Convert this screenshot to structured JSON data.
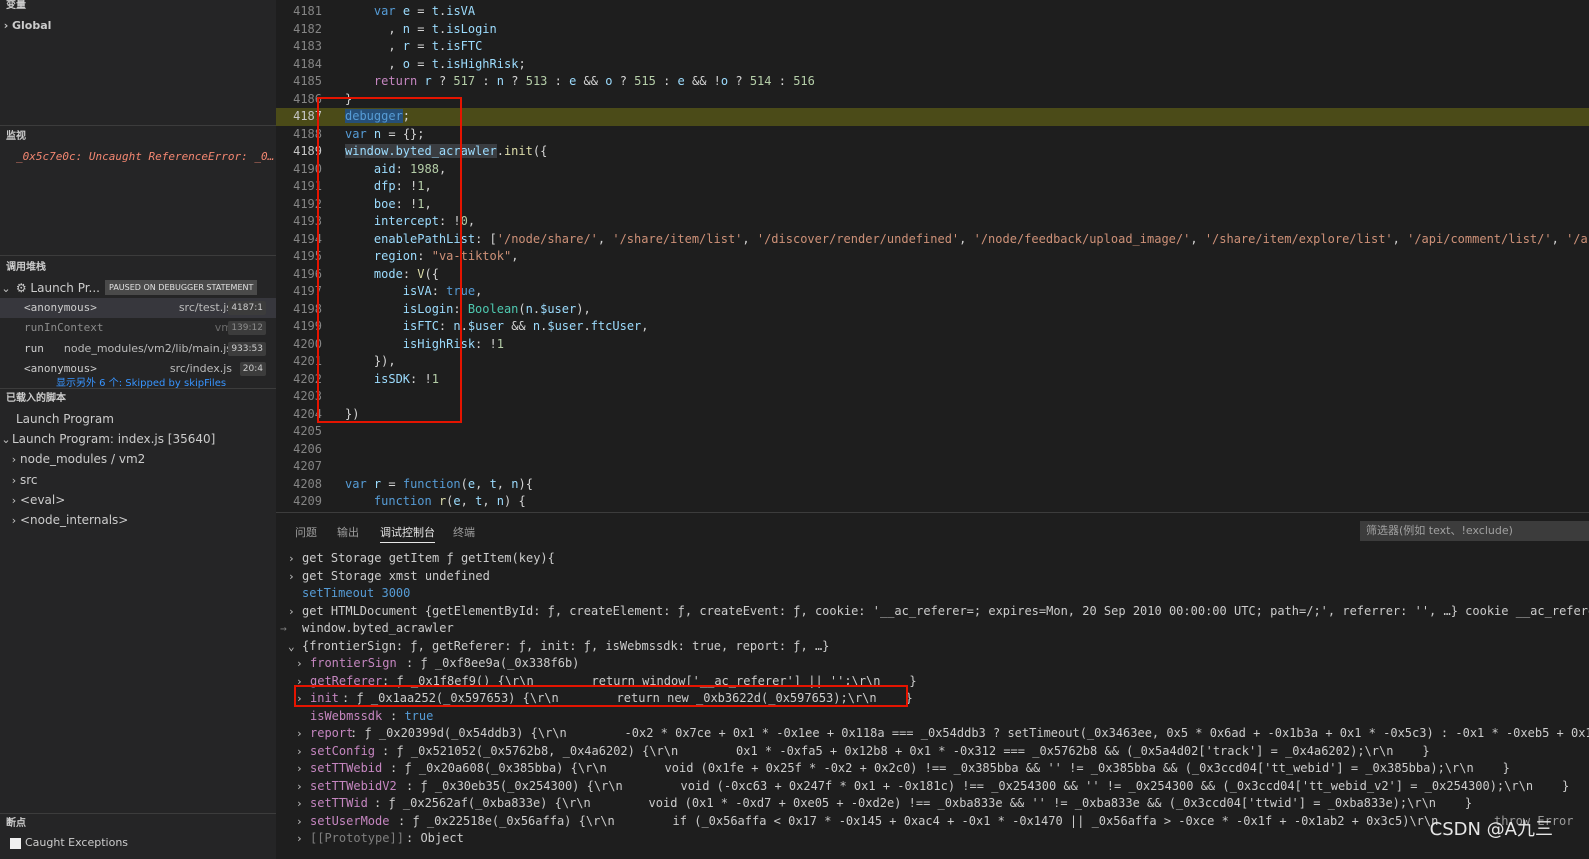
{
  "sidebar": {
    "variables_header": "变量",
    "global_label": "Global",
    "watch_header": "监视",
    "watch_item": "_0x5c7e0c: Uncaught ReferenceError: _0…",
    "callstack_header": "调用堆栈",
    "launch_label": "Launch Pr...",
    "paused_badge": "PAUSED ON DEBUGGER STATEMENT",
    "stack": [
      {
        "fn": "<anonymous>",
        "file": "src/test.js",
        "pos": "4187:1"
      },
      {
        "fn": "runInContext",
        "file": "vm",
        "pos": "139:12"
      },
      {
        "fn": "run",
        "file": "node_modules/vm2/lib/main.js",
        "pos": "933:53"
      },
      {
        "fn": "<anonymous>",
        "file": "src/index.js",
        "pos": "20:4"
      }
    ],
    "skipped_frames": "显示另外 6 个: Skipped by skipFiles",
    "loaded_scripts_header": "已载入的脚本",
    "scripts": [
      "Launch Program",
      "Launch Program: index.js [35640]",
      "node_modules / vm2",
      "src",
      "<eval>",
      "<node_internals>"
    ],
    "breakpoints_header": "断点",
    "caught_exceptions": "Caught Exceptions"
  },
  "editor": {
    "line_numbers": [
      "4181",
      "4182",
      "4183",
      "4184",
      "4185",
      "4186",
      "4187",
      "4188",
      "4189",
      "4190",
      "4191",
      "4192",
      "4193",
      "4194",
      "4195",
      "4196",
      "4197",
      "4198",
      "4199",
      "4200",
      "4201",
      "4202",
      "4203",
      "4204",
      "4205",
      "4206",
      "4207",
      "4208",
      "4209"
    ],
    "current_line": "4187"
  },
  "panel": {
    "tabs": [
      "问题",
      "输出",
      "调试控制台",
      "终端"
    ],
    "active_tab": "调试控制台",
    "filter_placeholder": "筛选器(例如 text、!exclude)",
    "console": {
      "storage_getitem": "get Storage getItem ƒ getItem(key){",
      "storage_xmst": "get Storage xmst undefined",
      "settimeout": "setTimeout 3000",
      "htmldoc": "get HTMLDocument {getElementById: ƒ, createElement: ƒ, createEvent: ƒ, cookie: '__ac_referer=; expires=Mon, 20 Sep 2010 00:00:00 UTC; path=/;', referrer: '', …} cookie __ac_referer",
      "input": "window.byted_acrawler",
      "result": "{frontierSign: ƒ, getReferer: ƒ, init: ƒ, isWebmssdk: true, report: ƒ, …}",
      "props": [
        {
          "key": "frontierSign",
          "val": "ƒ _0xf8ee9a(_0x338f6b)"
        },
        {
          "key": "getReferer",
          "val": "ƒ _0x1f8ef9() {\\r\\n        return window['__ac_referer'] || '';\\r\\n    }"
        },
        {
          "key": "init",
          "val": "ƒ _0x1aa252(_0x597653) {\\r\\n        return new _0xb3622d(_0x597653);\\r\\n    }"
        },
        {
          "key": "isWebmssdk",
          "val": "true"
        },
        {
          "key": "report",
          "val": "ƒ _0x20399d(_0x54ddb3) {\\r\\n        -0x2 * 0x7ce + 0x1 * -0x1ee + 0x118a === _0x54ddb3 ? setTimeout(_0x3463ee, 0x5 * 0x6ad + -0x1b3a + 0x1 * -0x5c3) : -0x1 * -0xeb5 + 0x1"
        },
        {
          "key": "setConfig",
          "val": "ƒ _0x521052(_0x5762b8, _0x4a6202) {\\r\\n        0x1 * -0xfa5 + 0x12b8 + 0x1 * -0x312 === _0x5762b8 && (_0x5a4d02['track'] = _0x4a6202);\\r\\n    }"
        },
        {
          "key": "setTTWebid",
          "val": "ƒ _0x20a608(_0x385bba) {\\r\\n        void (0x1fe + 0x25f * -0x2 + 0x2c0) !== _0x385bba && '' != _0x385bba && (_0x3ccd04['tt_webid'] = _0x385bba);\\r\\n    }"
        },
        {
          "key": "setTTWebidV2",
          "val": "ƒ _0x30eb35(_0x254300) {\\r\\n        void (-0xc63 + 0x247f * 0x1 + -0x181c) !== _0x254300 && '' != _0x254300 && (_0x3ccd04['tt_webid_v2'] = _0x254300);\\r\\n    }"
        },
        {
          "key": "setTTWid",
          "val": "ƒ _0x2562af(_0xba833e) {\\r\\n        void (0x1 * -0xd7 + 0xe05 + -0xd2e) !== _0xba833e && '' != _0xba833e && (_0x3ccd04['ttwid'] = _0xba833e);\\r\\n    }"
        },
        {
          "key": "setUserMode",
          "val": "ƒ _0x22518e(_0x56affa) {\\r\\n        if (_0x56affa < 0x17 * -0x145 + 0xac4 + -0x1 * -0x1470 || _0x56affa > -0xce * -0x1f + -0x1ab2 + 0x3c5)\\r\\n"
        },
        {
          "key": "[[Prototype]]",
          "val": "Object"
        }
      ],
      "throw_text": "throw Error"
    }
  },
  "watermark": "CSDN @A九三"
}
